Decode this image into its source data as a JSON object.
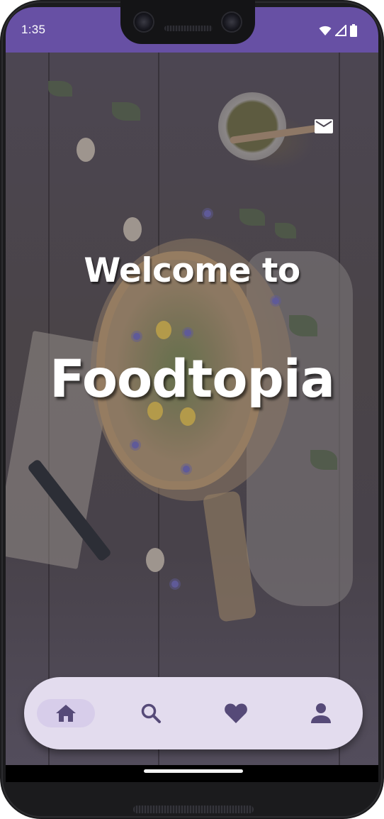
{
  "status_bar": {
    "time": "1:35",
    "background_color": "#6750a4",
    "icons": [
      "wifi-icon",
      "signal-icon",
      "battery-icon"
    ]
  },
  "header": {
    "mail_icon": "mail-icon"
  },
  "hero": {
    "welcome_text": "Welcome to",
    "brand_name": "Foodtopia"
  },
  "bottom_nav": {
    "background_color": "#e3dcee",
    "indicator_color": "#d7cdea",
    "icon_color": "#564a78",
    "selected": "home",
    "items": [
      {
        "id": "home",
        "icon": "home-icon"
      },
      {
        "id": "search",
        "icon": "search-icon"
      },
      {
        "id": "favorites",
        "icon": "heart-icon"
      },
      {
        "id": "profile",
        "icon": "person-icon"
      }
    ]
  }
}
